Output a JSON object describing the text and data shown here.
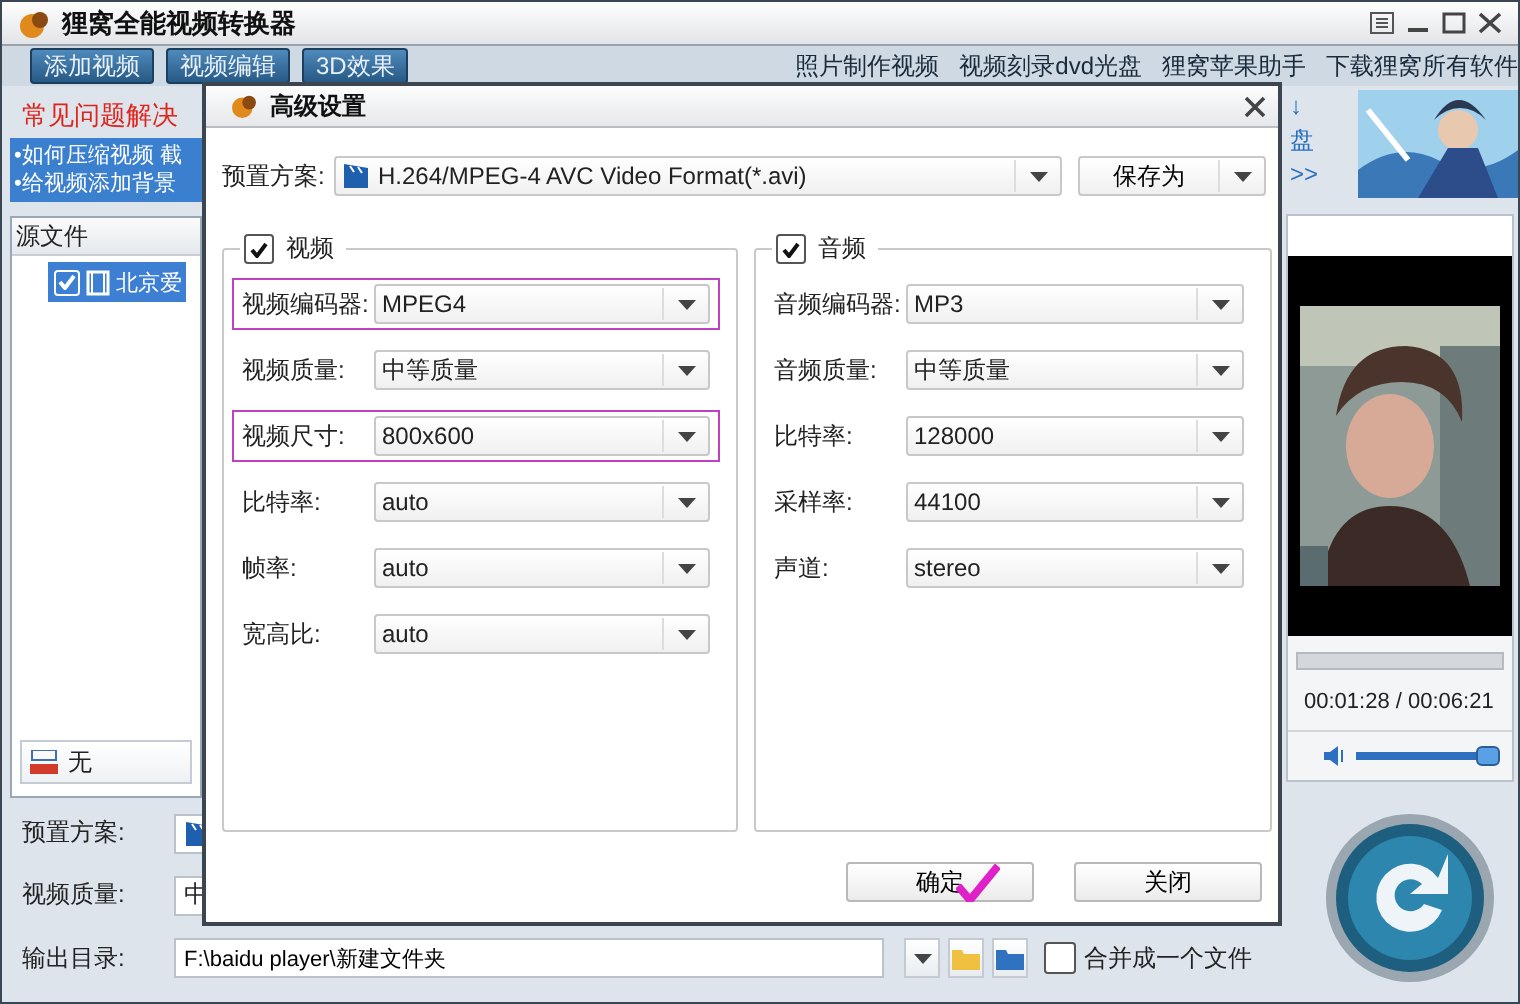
{
  "window": {
    "title": "狸窝全能视频转换器"
  },
  "toolbar": {
    "buttons": [
      "添加视频",
      "视频编辑",
      "3D效果"
    ],
    "links": [
      "照片制作视频",
      "视频刻录dvd光盘",
      "狸窝苹果助手",
      "下载狸窝所有软件"
    ]
  },
  "faq": {
    "title": "常见问题解决",
    "items": [
      "•如何压缩视频 截",
      "•给视频添加背景"
    ]
  },
  "ad": {
    "texts": [
      "↓",
      "盘",
      ">>"
    ]
  },
  "file_list": {
    "header": "源文件",
    "rows": [
      {
        "name": "北京爱",
        "checked": true,
        "selected": true
      }
    ]
  },
  "subtitle": {
    "value": "无"
  },
  "player": {
    "time": "00:01:28 / 00:06:21",
    "volume": {
      "level": 0.92
    }
  },
  "output": {
    "preset_label": "预置方案:",
    "quality_label": "视频质量:",
    "quality_value": "中",
    "dir_label": "输出目录:",
    "dir_value": "F:\\baidu player\\新建文件夹",
    "merge": {
      "label": "合并成一个文件",
      "checked": false
    }
  },
  "dialog": {
    "title": "高级设置",
    "preset": {
      "label": "预置方案:",
      "value": "H.264/MPEG-4 AVC Video Format(*.avi)"
    },
    "save_button": "保存为",
    "groups": [
      {
        "title": "视频",
        "checked": true,
        "fields": [
          {
            "label": "视频编码器:",
            "value": "MPEG4",
            "highlighted": true
          },
          {
            "label": "视频质量:",
            "value": "中等质量",
            "highlighted": false
          },
          {
            "label": "视频尺寸:",
            "value": "800x600",
            "highlighted": true
          },
          {
            "label": "比特率:",
            "value": "auto",
            "highlighted": false
          },
          {
            "label": "帧率:",
            "value": "auto",
            "highlighted": false
          },
          {
            "label": "宽高比:",
            "value": "auto",
            "highlighted": false
          }
        ]
      },
      {
        "title": "音频",
        "checked": true,
        "fields": [
          {
            "label": "音频编码器:",
            "value": "MP3",
            "highlighted": false
          },
          {
            "label": "音频质量:",
            "value": "中等质量",
            "highlighted": false
          },
          {
            "label": "比特率:",
            "value": "128000",
            "highlighted": false
          },
          {
            "label": "采样率:",
            "value": "44100",
            "highlighted": false
          },
          {
            "label": "声道:",
            "value": "stereo",
            "highlighted": false
          }
        ]
      }
    ],
    "buttons": [
      {
        "label": "确定",
        "marked": true
      },
      {
        "label": "关闭",
        "marked": false
      }
    ]
  }
}
